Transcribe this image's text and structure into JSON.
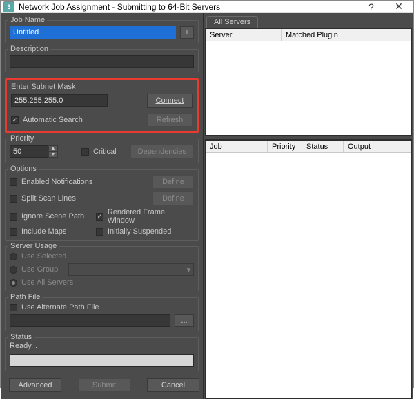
{
  "titlebar": {
    "title": "Network Job Assignment - Submitting to 64-Bit Servers",
    "help": "?",
    "close": "✕"
  },
  "jobname": {
    "label": "Job Name",
    "value": "Untitled",
    "plus": "+"
  },
  "description": {
    "label": "Description",
    "value": ""
  },
  "subnet": {
    "label": "Enter Subnet Mask",
    "value": "255.255.255.0",
    "connect": "Connect",
    "refresh": "Refresh",
    "auto_label": "Automatic Search",
    "auto_check": "✓"
  },
  "priority": {
    "label": "Priority",
    "value": "50",
    "critical": "Critical",
    "dependencies": "Dependencies"
  },
  "options": {
    "label": "Options",
    "enabled_notifications": "Enabled Notifications",
    "define1": "Define",
    "split_scan": "Split Scan Lines",
    "define2": "Define",
    "ignore_scene": "Ignore Scene Path",
    "rendered_frame": "Rendered Frame Window",
    "rendered_check": "✓",
    "include_maps": "Include Maps",
    "initially_susp": "Initially Suspended"
  },
  "server_usage": {
    "label": "Server Usage",
    "use_selected": "Use Selected",
    "use_group": "Use Group",
    "use_all": "Use All Servers"
  },
  "path_file": {
    "label": "Path File",
    "use_alt": "Use Alternate Path File",
    "value": "",
    "browse": "..."
  },
  "status": {
    "label": "Status",
    "text": "Ready..."
  },
  "footer": {
    "advanced": "Advanced",
    "submit": "Submit",
    "cancel": "Cancel"
  },
  "right": {
    "tab_all": "All Servers",
    "top_cols": {
      "server": "Server",
      "plugin": "Matched Plugin"
    },
    "bottom_cols": {
      "job": "Job",
      "priority": "Priority",
      "status": "Status",
      "output": "Output"
    }
  }
}
